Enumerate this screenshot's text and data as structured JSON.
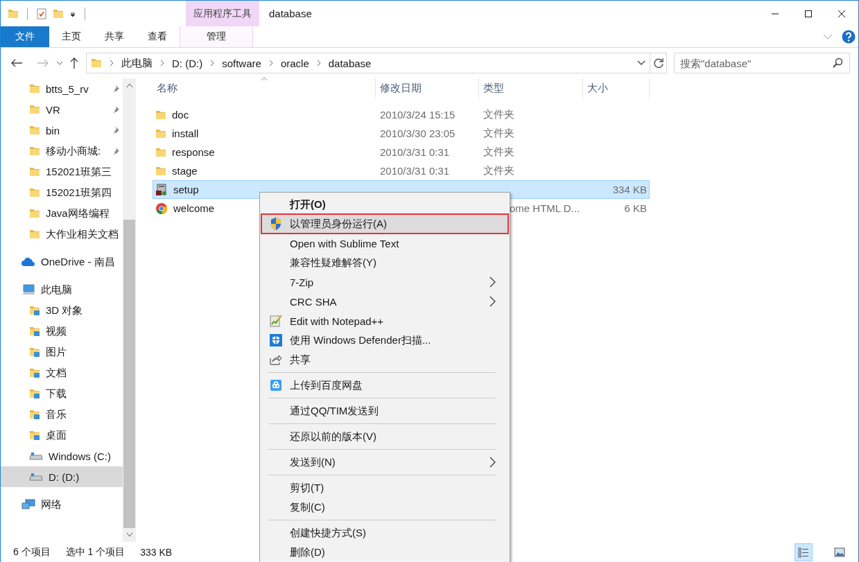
{
  "window": {
    "title": "database",
    "contextual_group": "应用程序工具"
  },
  "ribbon": {
    "tabs": [
      {
        "label": "文件",
        "kind": "file"
      },
      {
        "label": "主页",
        "kind": "normal"
      },
      {
        "label": "共享",
        "kind": "normal"
      },
      {
        "label": "查看",
        "kind": "normal"
      },
      {
        "label": "管理",
        "kind": "contextual"
      }
    ]
  },
  "address": {
    "breadcrumbs": [
      "此电脑",
      "D: (D:)",
      "software",
      "oracle",
      "database"
    ]
  },
  "search": {
    "placeholder": "搜索\"database\""
  },
  "sidebar": {
    "quick_access": [
      {
        "label": "btts_5_rv",
        "kind": "folder",
        "pinned": true,
        "selected": false
      },
      {
        "label": "VR",
        "kind": "folder",
        "pinned": true,
        "selected": false
      },
      {
        "label": "bin",
        "kind": "folder",
        "pinned": true,
        "selected": false
      },
      {
        "label": "移动小商城:",
        "kind": "folder",
        "pinned": true,
        "selected": false
      },
      {
        "label": "152021班第三",
        "kind": "folder",
        "pinned": false,
        "selected": false
      },
      {
        "label": "152021班第四",
        "kind": "folder",
        "pinned": false,
        "selected": false
      },
      {
        "label": "Java网络编程",
        "kind": "folder",
        "pinned": false,
        "selected": false
      },
      {
        "label": "大作业相关文档",
        "kind": "folder",
        "pinned": false,
        "selected": false
      }
    ],
    "items": [
      {
        "label": "OneDrive - 南昌",
        "kind": "cloud",
        "selected": false
      },
      {
        "label": "此电脑",
        "kind": "computer",
        "selected": false,
        "children": [
          {
            "label": "3D 对象",
            "kind": "special",
            "selected": false
          },
          {
            "label": "视频",
            "kind": "special",
            "selected": false
          },
          {
            "label": "图片",
            "kind": "special",
            "selected": false
          },
          {
            "label": "文档",
            "kind": "special",
            "selected": false
          },
          {
            "label": "下载",
            "kind": "special",
            "selected": false
          },
          {
            "label": "音乐",
            "kind": "special",
            "selected": false
          },
          {
            "label": "桌面",
            "kind": "special",
            "selected": false
          },
          {
            "label": "Windows (C:)",
            "kind": "drive",
            "selected": false
          },
          {
            "label": "D: (D:)",
            "kind": "drive",
            "selected": true
          }
        ]
      },
      {
        "label": "网络",
        "kind": "network",
        "selected": false
      }
    ]
  },
  "file_list": {
    "columns": [
      "名称",
      "修改日期",
      "类型",
      "大小"
    ],
    "rows": [
      {
        "name": "doc",
        "kind": "folder",
        "modified": "2010/3/24 15:15",
        "type": "文件夹",
        "selected": false
      },
      {
        "name": "install",
        "kind": "folder",
        "modified": "2010/3/30 23:05",
        "type": "文件夹",
        "selected": false
      },
      {
        "name": "response",
        "kind": "folder",
        "modified": "2010/3/31 0:31",
        "type": "文件夹",
        "selected": false
      },
      {
        "name": "stage",
        "kind": "folder",
        "modified": "2010/3/31 0:31",
        "type": "文件夹",
        "selected": false
      },
      {
        "name": "setup",
        "kind": "app",
        "size": "334 KB",
        "selected": true
      },
      {
        "name": "welcome",
        "kind": "web",
        "type": "ome HTML D...",
        "type_partly_hidden": true,
        "size": "6 KB",
        "selected": false
      }
    ]
  },
  "context_menu": {
    "items": [
      {
        "kind": "item",
        "label": "打开(O)",
        "default": true,
        "highlighted": false,
        "marked": false,
        "submenu": false
      },
      {
        "kind": "shield",
        "label": "以管理员身份运行(A)",
        "default": false,
        "highlighted": true,
        "marked": true,
        "submenu": false
      },
      {
        "kind": "item",
        "label": "Open with Sublime Text",
        "default": false,
        "highlighted": false,
        "marked": false,
        "submenu": false
      },
      {
        "kind": "item",
        "label": "兼容性疑难解答(Y)",
        "default": false,
        "highlighted": false,
        "marked": false,
        "submenu": false
      },
      {
        "kind": "item",
        "label": "7-Zip",
        "default": false,
        "highlighted": false,
        "marked": false,
        "submenu": true
      },
      {
        "kind": "item",
        "label": "CRC SHA",
        "default": false,
        "highlighted": false,
        "marked": false,
        "submenu": true
      },
      {
        "kind": "notepad",
        "label": "Edit with Notepad++",
        "default": false,
        "highlighted": false,
        "marked": false,
        "submenu": false
      },
      {
        "kind": "defender",
        "label": "使用 Windows Defender扫描...",
        "default": false,
        "highlighted": false,
        "marked": false,
        "submenu": false
      },
      {
        "kind": "share",
        "label": "共享",
        "default": false,
        "highlighted": false,
        "marked": false,
        "submenu": false
      },
      {
        "kind": "separator"
      },
      {
        "kind": "cloud-drive",
        "label": "上传到百度网盘",
        "default": false,
        "highlighted": false,
        "marked": false,
        "submenu": false
      },
      {
        "kind": "separator"
      },
      {
        "kind": "item",
        "label": "通过QQ/TIM发送到",
        "default": false,
        "highlighted": false,
        "marked": false,
        "submenu": false
      },
      {
        "kind": "separator"
      },
      {
        "kind": "item",
        "label": "还原以前的版本(V)",
        "default": false,
        "highlighted": false,
        "marked": false,
        "submenu": false
      },
      {
        "kind": "separator"
      },
      {
        "kind": "item",
        "label": "发送到(N)",
        "default": false,
        "highlighted": false,
        "marked": false,
        "submenu": true
      },
      {
        "kind": "separator"
      },
      {
        "kind": "item",
        "label": "剪切(T)",
        "default": false,
        "highlighted": false,
        "marked": false,
        "submenu": false
      },
      {
        "kind": "item",
        "label": "复制(C)",
        "default": false,
        "highlighted": false,
        "marked": false,
        "submenu": false
      },
      {
        "kind": "separator"
      },
      {
        "kind": "item",
        "label": "创建快捷方式(S)",
        "default": false,
        "highlighted": false,
        "marked": false,
        "submenu": false
      },
      {
        "kind": "item",
        "label": "删除(D)",
        "default": false,
        "highlighted": false,
        "marked": false,
        "submenu": false
      }
    ]
  },
  "status_bar": {
    "item_count": "6 个项目",
    "selection": "选中 1 个项目",
    "selection_size": "333 KB",
    "view_buttons": [
      {
        "kind": "details",
        "selected": true
      },
      {
        "kind": "thumbnails",
        "selected": false
      }
    ]
  }
}
